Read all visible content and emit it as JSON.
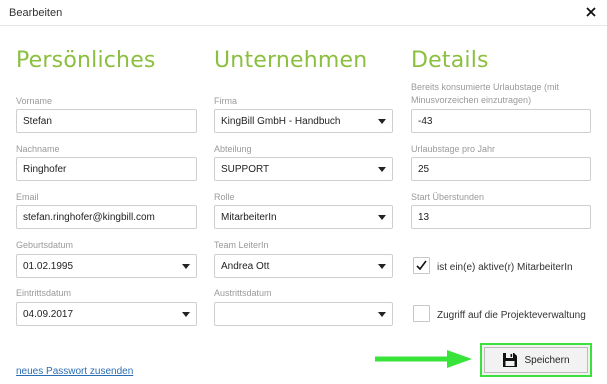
{
  "window": {
    "title": "Bearbeiten"
  },
  "sections": {
    "personal": "Persönliches",
    "company": "Unternehmen",
    "details": "Details"
  },
  "personal": {
    "vorname_label": "Vorname",
    "vorname_value": "Stefan",
    "nachname_label": "Nachname",
    "nachname_value": "Ringhofer",
    "email_label": "Email",
    "email_value": "stefan.ringhofer@kingbill.com",
    "geburtsdatum_label": "Geburtsdatum",
    "geburtsdatum_value": "01.02.1995",
    "eintrittsdatum_label": "Eintrittsdatum",
    "eintrittsdatum_value": "04.09.2017"
  },
  "company": {
    "firma_label": "Firma",
    "firma_value": "KingBill GmbH - Handbuch",
    "abteilung_label": "Abteilung",
    "abteilung_value": "SUPPORT",
    "rolle_label": "Rolle",
    "rolle_value": "MitarbeiterIn",
    "teamleiter_label": "Team LeiterIn",
    "teamleiter_value": "Andrea Ott",
    "austritt_label": "Austrittsdatum",
    "austritt_value": ""
  },
  "details": {
    "urlaub_konsumiert_label_line1": "Bereits konsumierte Urlaubstage (mit",
    "urlaub_konsumiert_label_line2": "Minusvorzeichen einzutragen)",
    "urlaub_konsumiert_value": "-43",
    "urlaub_pro_jahr_label": "Urlaubstage pro Jahr",
    "urlaub_pro_jahr_value": "25",
    "start_ueberstunden_label": "Start Überstunden",
    "start_ueberstunden_value": "13",
    "aktiv_label": "ist ein(e) aktive(r) MitarbeiterIn",
    "aktiv_checked": true,
    "projekt_label": "Zugriff auf die Projekteverwaltung",
    "projekt_checked": false
  },
  "footer": {
    "reset_password_link": "neues Passwort zusenden",
    "save_label": "Speichern"
  },
  "colors": {
    "heading": "#8bbf3f",
    "highlight": "#39e43a",
    "link": "#2a6db3"
  }
}
